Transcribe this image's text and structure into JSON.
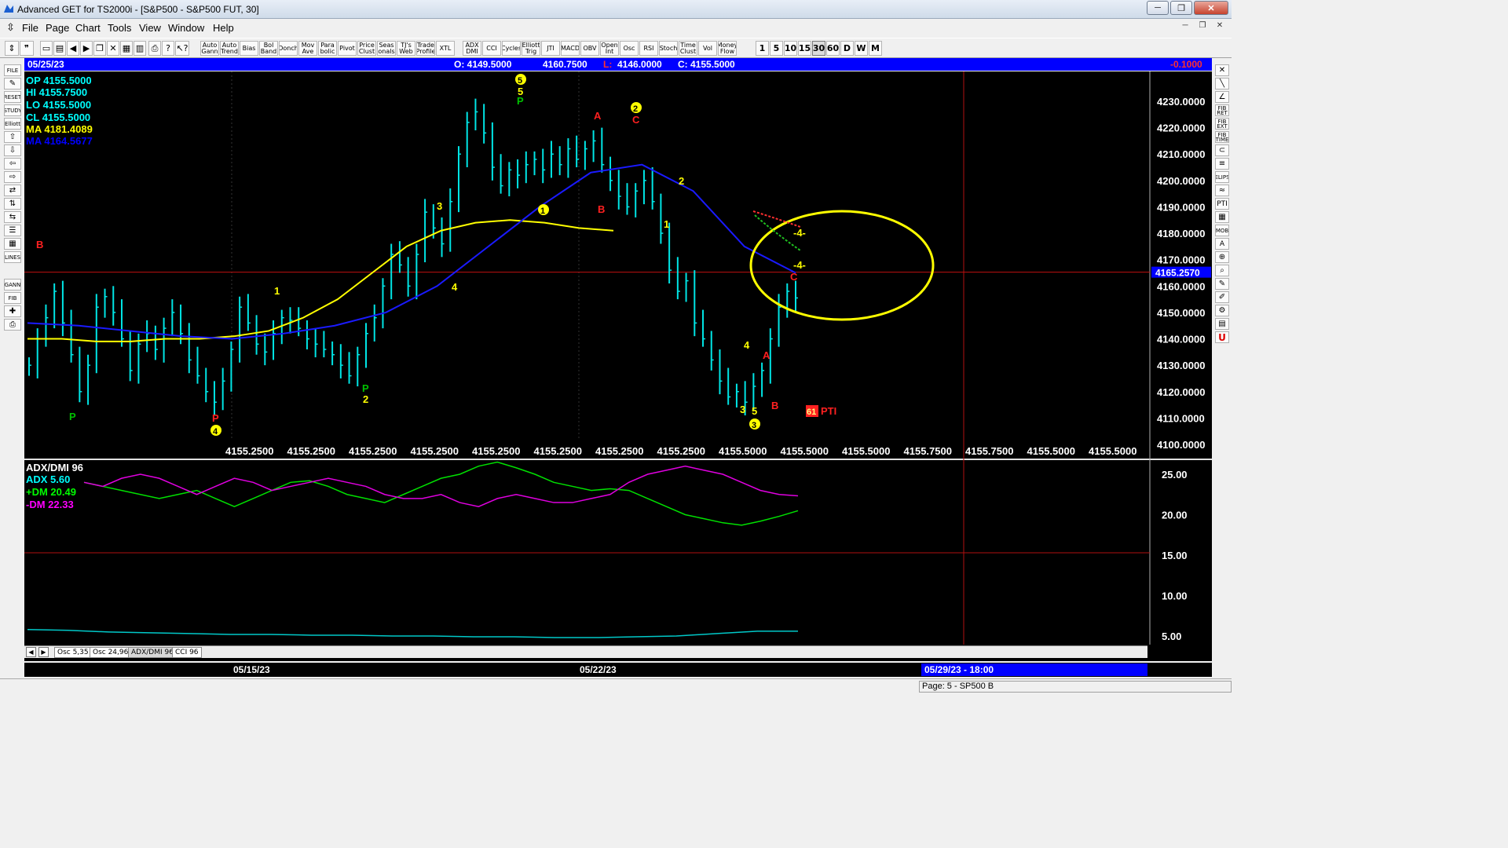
{
  "window": {
    "title": "Advanced GET for TS2000i - [S&P500 - S&P500 FUT, 30]",
    "minimize": "─",
    "restore": "❐",
    "close": "✕"
  },
  "menu": [
    "File",
    "Page",
    "Chart",
    "Tools",
    "View",
    "Window",
    "Help"
  ],
  "toolbar": {
    "studies": [
      "Auto Gann",
      "Auto Trend",
      "Bias",
      "Bol Band",
      "Donch",
      "Mov Ave",
      "Para bolic",
      "Pivot",
      "Price Clust",
      "Seas onals",
      "TJ's Web",
      "Trade Profile",
      "XTL",
      "ADX DMI",
      "CCI",
      "Cycles",
      "Elliott Trig",
      "JTI",
      "MACD",
      "OBV",
      "Open Int",
      "Osc",
      "RSI",
      "Stoch",
      "Time Clust",
      "Vol",
      "Money Flow"
    ],
    "periods": [
      "1",
      "5",
      "10",
      "15",
      "30",
      "60",
      "D",
      "W",
      "M"
    ],
    "selected_period": "30"
  },
  "left_tools": [
    "FILE",
    "",
    "RESET",
    "STUDY",
    "Elliott",
    "",
    "",
    "",
    "",
    "",
    "",
    "",
    "",
    "",
    "LINES",
    "GANN",
    "FIB",
    "",
    ""
  ],
  "right_tools": [
    "",
    "",
    "",
    "FIB RET",
    "FIB EXT",
    "FIB TIME",
    "",
    "",
    "ELIPS",
    "",
    "PTI",
    "",
    "MOB",
    "A",
    "",
    "",
    "",
    "",
    "",
    "",
    "U"
  ],
  "header": {
    "date": "05/25/23",
    "open": "O: 4149.5000",
    "high": "4160.7500",
    "low_label": "L:",
    "low": "4146.0000",
    "close": "C: 4155.5000",
    "change": "-0.1000"
  },
  "info": {
    "op": "OP  4155.5000",
    "hi": "HI   4155.7500",
    "lo": "LO  4155.5000",
    "cl": "CL  4155.5000",
    "ma1": "MA  4181.4089",
    "ma2": "MA  4164.5677"
  },
  "colors": {
    "bars": "#00e5e5",
    "ma_yellow": "#ffff00",
    "ma_blue": "#0000ff",
    "adx": "#00ffff",
    "plus_dm": "#00ff00",
    "minus_dm": "#ff00ff",
    "red_label": "#ff2020",
    "green_label": "#00c000"
  },
  "price_axis": [
    "4230.0000",
    "4220.0000",
    "4210.0000",
    "4200.0000",
    "4190.0000",
    "4180.0000",
    "4170.0000",
    "4160.0000",
    "4150.0000",
    "4140.0000",
    "4130.0000",
    "4120.0000",
    "4110.0000",
    "4100.0000"
  ],
  "current_price": "4165.2570",
  "bottom_values": [
    "4155.2500",
    "4155.2500",
    "4155.2500",
    "4155.2500",
    "4155.2500",
    "4155.2500",
    "4155.2500",
    "4155.2500",
    "4155.5000",
    "4155.5000",
    "4155.5000",
    "4155.7500",
    "4155.7500",
    "4155.5000",
    "4155.5000"
  ],
  "osc": {
    "title": "ADX/DMI 96",
    "adx": "ADX 5.60",
    "plus_dm": "+DM 20.49",
    "minus_dm": "-DM  22.33",
    "axis": [
      "25.00",
      "20.00",
      "15.00",
      "10.00",
      "5.00"
    ]
  },
  "labels": {
    "B": "B",
    "A": "A",
    "C": "C",
    "P": "P",
    "n1": "1",
    "n2": "2",
    "n3": "3",
    "n4": "4",
    "n5": "5",
    "m4": "-4-",
    "pti_box": "61",
    "pti": "PTI"
  },
  "tabs": [
    "Osc 5,35",
    "Osc 24,96",
    "ADX/DMI 96",
    "CCI 96"
  ],
  "time_axis": {
    "d1": "05/15/23",
    "d2": "05/22/23",
    "cursor": "05/29/23 - 18:00"
  },
  "status": "Page: 5 - SP500 B",
  "chart_data": {
    "type": "candlestick",
    "y_range": [
      4100,
      4235
    ],
    "x_dates": [
      "05/15/23",
      "05/22/23",
      "05/29/23 - 18:00"
    ],
    "ohlc_last": {
      "open": 4149.5,
      "high": 4160.75,
      "low": 4146.0,
      "close": 4155.5
    },
    "closes": [
      4130,
      4140,
      4148,
      4158,
      4146,
      4134,
      4120,
      4130,
      4152,
      4156,
      4150,
      4140,
      4128,
      4138,
      4142,
      4136,
      4144,
      4150,
      4142,
      4132,
      4126,
      4120,
      4116,
      4124,
      4136,
      4152,
      4146,
      4138,
      4135,
      4142,
      4148,
      4147,
      4144,
      4140,
      4138,
      4136,
      4134,
      4130,
      4126,
      4134,
      4142,
      4148,
      4160,
      4172,
      4168,
      4160,
      4172,
      4188,
      4182,
      4176,
      4192,
      4210,
      4222,
      4226,
      4218,
      4205,
      4198,
      4204,
      4202,
      4206,
      4208,
      4204,
      4210,
      4206,
      4212,
      4208,
      4212,
      4215,
      4206,
      4200,
      4194,
      4190,
      4196,
      4200,
      4192,
      4180,
      4166,
      4158,
      4162,
      4146,
      4140,
      4132,
      4124,
      4118,
      4120,
      4116,
      4122,
      4128,
      4140,
      4152,
      4158,
      4155.5
    ],
    "ma_yellow": [
      4140,
      4140,
      4139,
      4139,
      4140,
      4140,
      4141,
      4143,
      4148,
      4155,
      4165,
      4175,
      4181,
      4184,
      4185,
      4184,
      4182,
      4181
    ],
    "ma_blue": [
      4146,
      4145,
      4143,
      4141,
      4140,
      4142,
      4145,
      4150,
      4160,
      4175,
      4190,
      4203,
      4206,
      4196,
      4175,
      4165
    ],
    "adx_dmi": {
      "adx": 5.6,
      "plus_dm": 20.49,
      "minus_dm": 22.33,
      "y_range": [
        3,
        27
      ]
    }
  }
}
